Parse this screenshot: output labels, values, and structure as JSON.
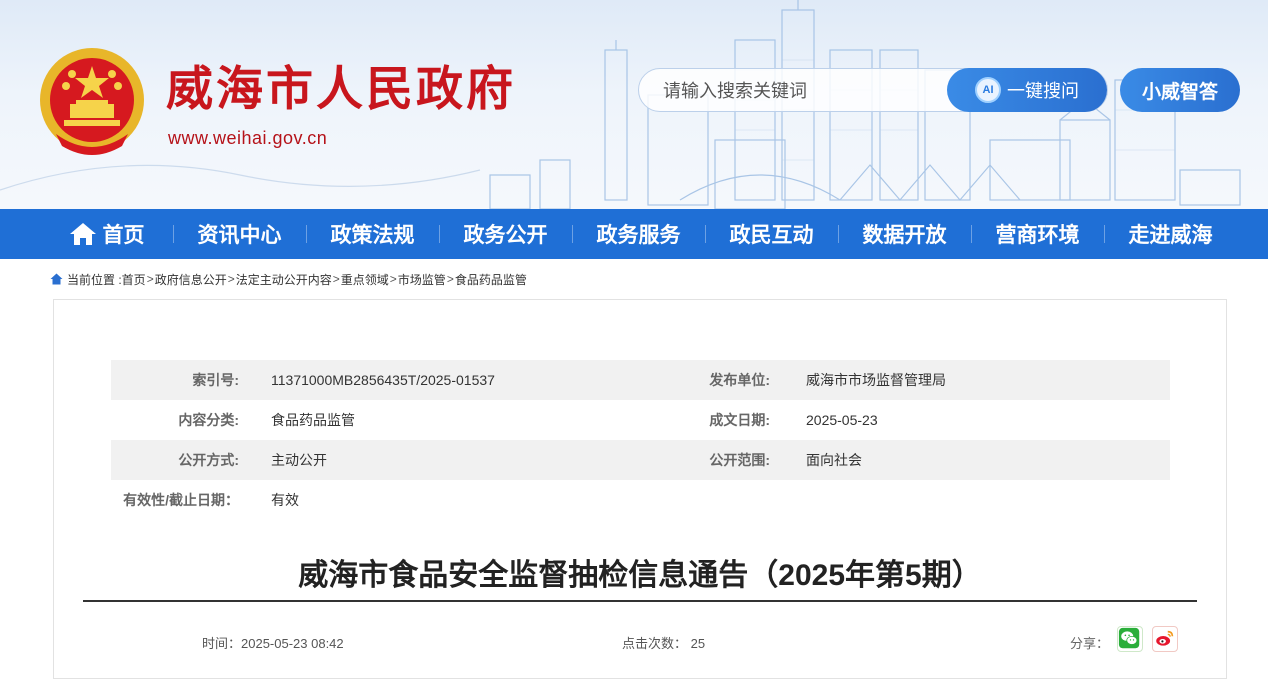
{
  "header": {
    "site_title": "威海市人民政府",
    "site_url": "www.weihai.gov.cn",
    "search_placeholder": "请输入搜索关键词",
    "ai_search_label": "一键搜问",
    "ai_icon_text": "AI",
    "xiaowei_label": "小威智答"
  },
  "nav": {
    "items": [
      {
        "label": "首页",
        "icon": "home-icon"
      },
      {
        "label": "资讯中心"
      },
      {
        "label": "政策法规"
      },
      {
        "label": "政务公开"
      },
      {
        "label": "政务服务"
      },
      {
        "label": "政民互动"
      },
      {
        "label": "数据开放"
      },
      {
        "label": "营商环境"
      },
      {
        "label": "走进威海"
      }
    ]
  },
  "breadcrumb": {
    "prefix": "当前位置 :",
    "items": [
      "首页",
      "政府信息公开",
      "法定主动公开内容",
      "重点领域",
      "市场监管",
      "食品药品监管"
    ],
    "separator": ">"
  },
  "meta": {
    "index_label": "索引号:",
    "index_value": "11371000MB2856435T/2025-01537",
    "publisher_label": "发布单位:",
    "publisher_value": "威海市市场监督管理局",
    "category_label": "内容分类:",
    "category_value": "食品药品监管",
    "date_label": "成文日期:",
    "date_value": "2025-05-23",
    "method_label": "公开方式:",
    "method_value": "主动公开",
    "scope_label": "公开范围:",
    "scope_value": "面向社会",
    "validity_label": "有效性/截止日期：",
    "validity_value": "有效"
  },
  "article": {
    "title": "威海市食品安全监督抽检信息通告（2025年第5期）",
    "time_text": "时间：2025-05-23 08:42",
    "clicks_text": "点击次数： 25",
    "share_label": "分享："
  },
  "colors": {
    "brand_red": "#c8161d",
    "nav_blue": "#1f6fd6",
    "button_blue": "#2a7be0",
    "wechat_green": "#2aae3a",
    "weibo_red": "#e6162d"
  }
}
